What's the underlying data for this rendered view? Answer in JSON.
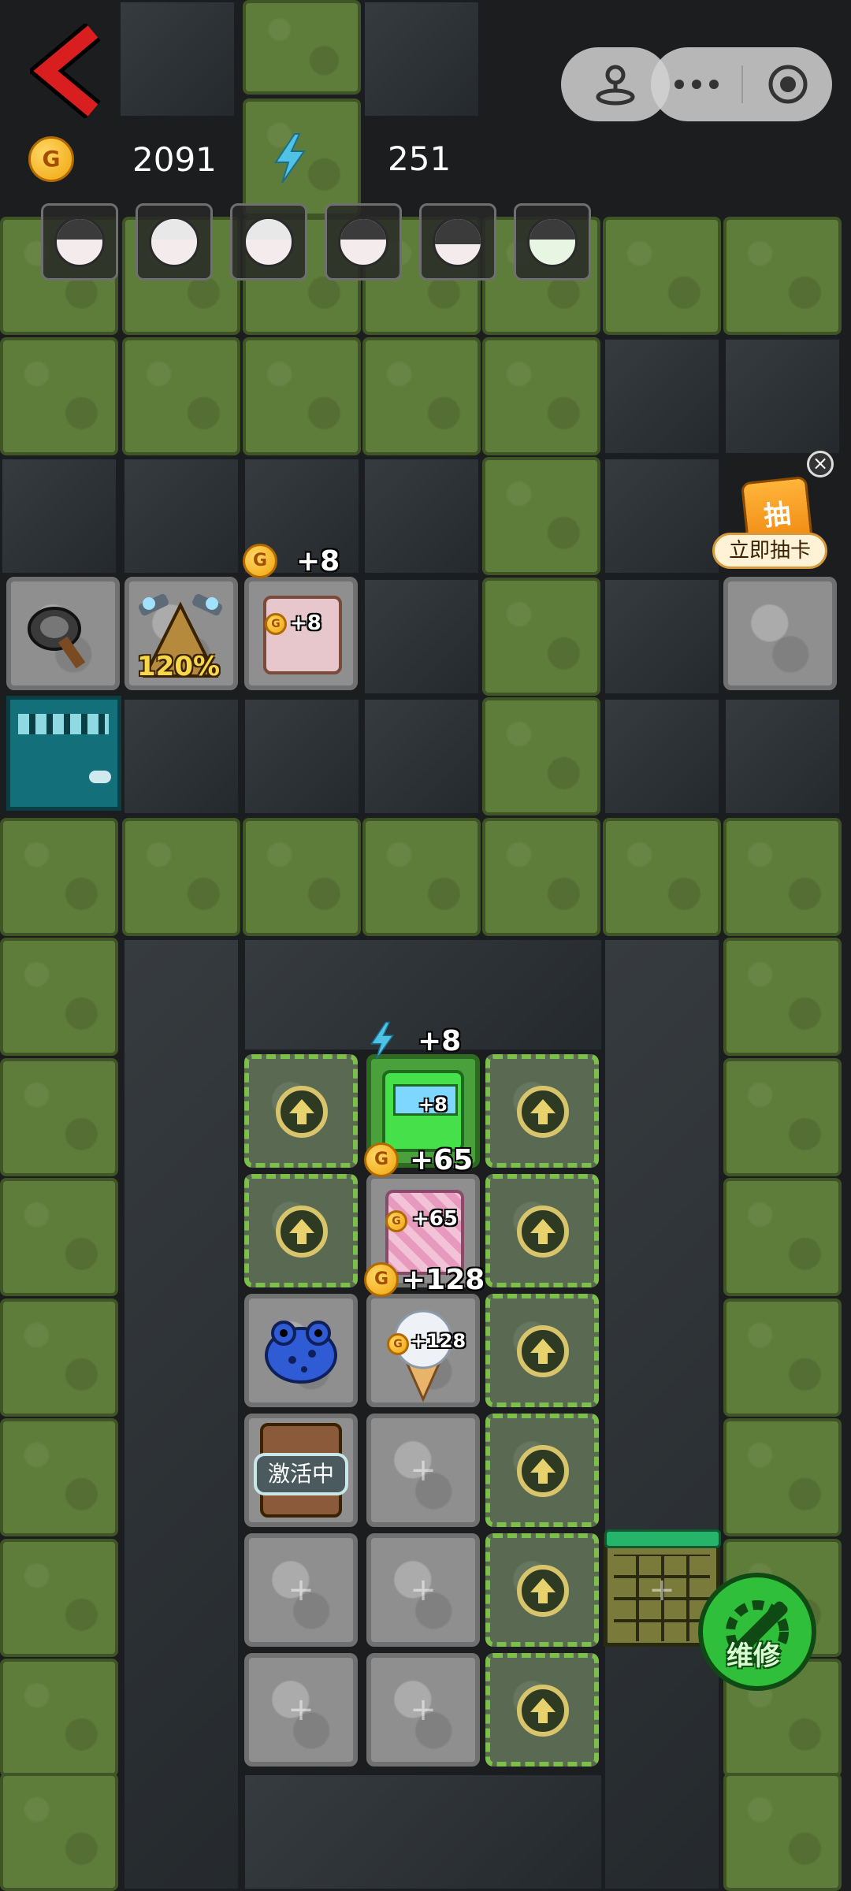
{
  "top_bar": {
    "back_icon": "chevron-left-icon",
    "joystick_icon": "joystick-icon",
    "more_icon": "more-dots-icon",
    "record_icon": "target-icon"
  },
  "resources": {
    "gold_icon_letter": "G",
    "gold": "2091",
    "energy": "251"
  },
  "characters": [
    {
      "name": "ghost-girl-1"
    },
    {
      "name": "granny-1"
    },
    {
      "name": "granny-2"
    },
    {
      "name": "ghost-girl-2"
    },
    {
      "name": "ghost-man"
    },
    {
      "name": "ghost-girl-green"
    }
  ],
  "promo": {
    "card_label": "抽",
    "button_label": "立即抽卡",
    "close_label": "×"
  },
  "top_room": {
    "bonus_percent": "120%",
    "bed_bonus_big": "+8",
    "bed_bonus_small": "+8"
  },
  "main_room": {
    "energy_bonus": "+8",
    "console_bonus": "+8",
    "bed_bonus_big": "+65",
    "bed_bonus_small": "+65",
    "icecream_bonus_big": "+128",
    "icecream_bonus_small": "+128",
    "activating_label": "激活中",
    "repair_label": "维修",
    "plus_symbol": "+"
  },
  "colors": {
    "grass": "#5f7d3a",
    "stone": "#2a2f33",
    "accent_red": "#d81e1e",
    "repair_green": "#2fbf3a",
    "promo_orange": "#f08a12"
  }
}
